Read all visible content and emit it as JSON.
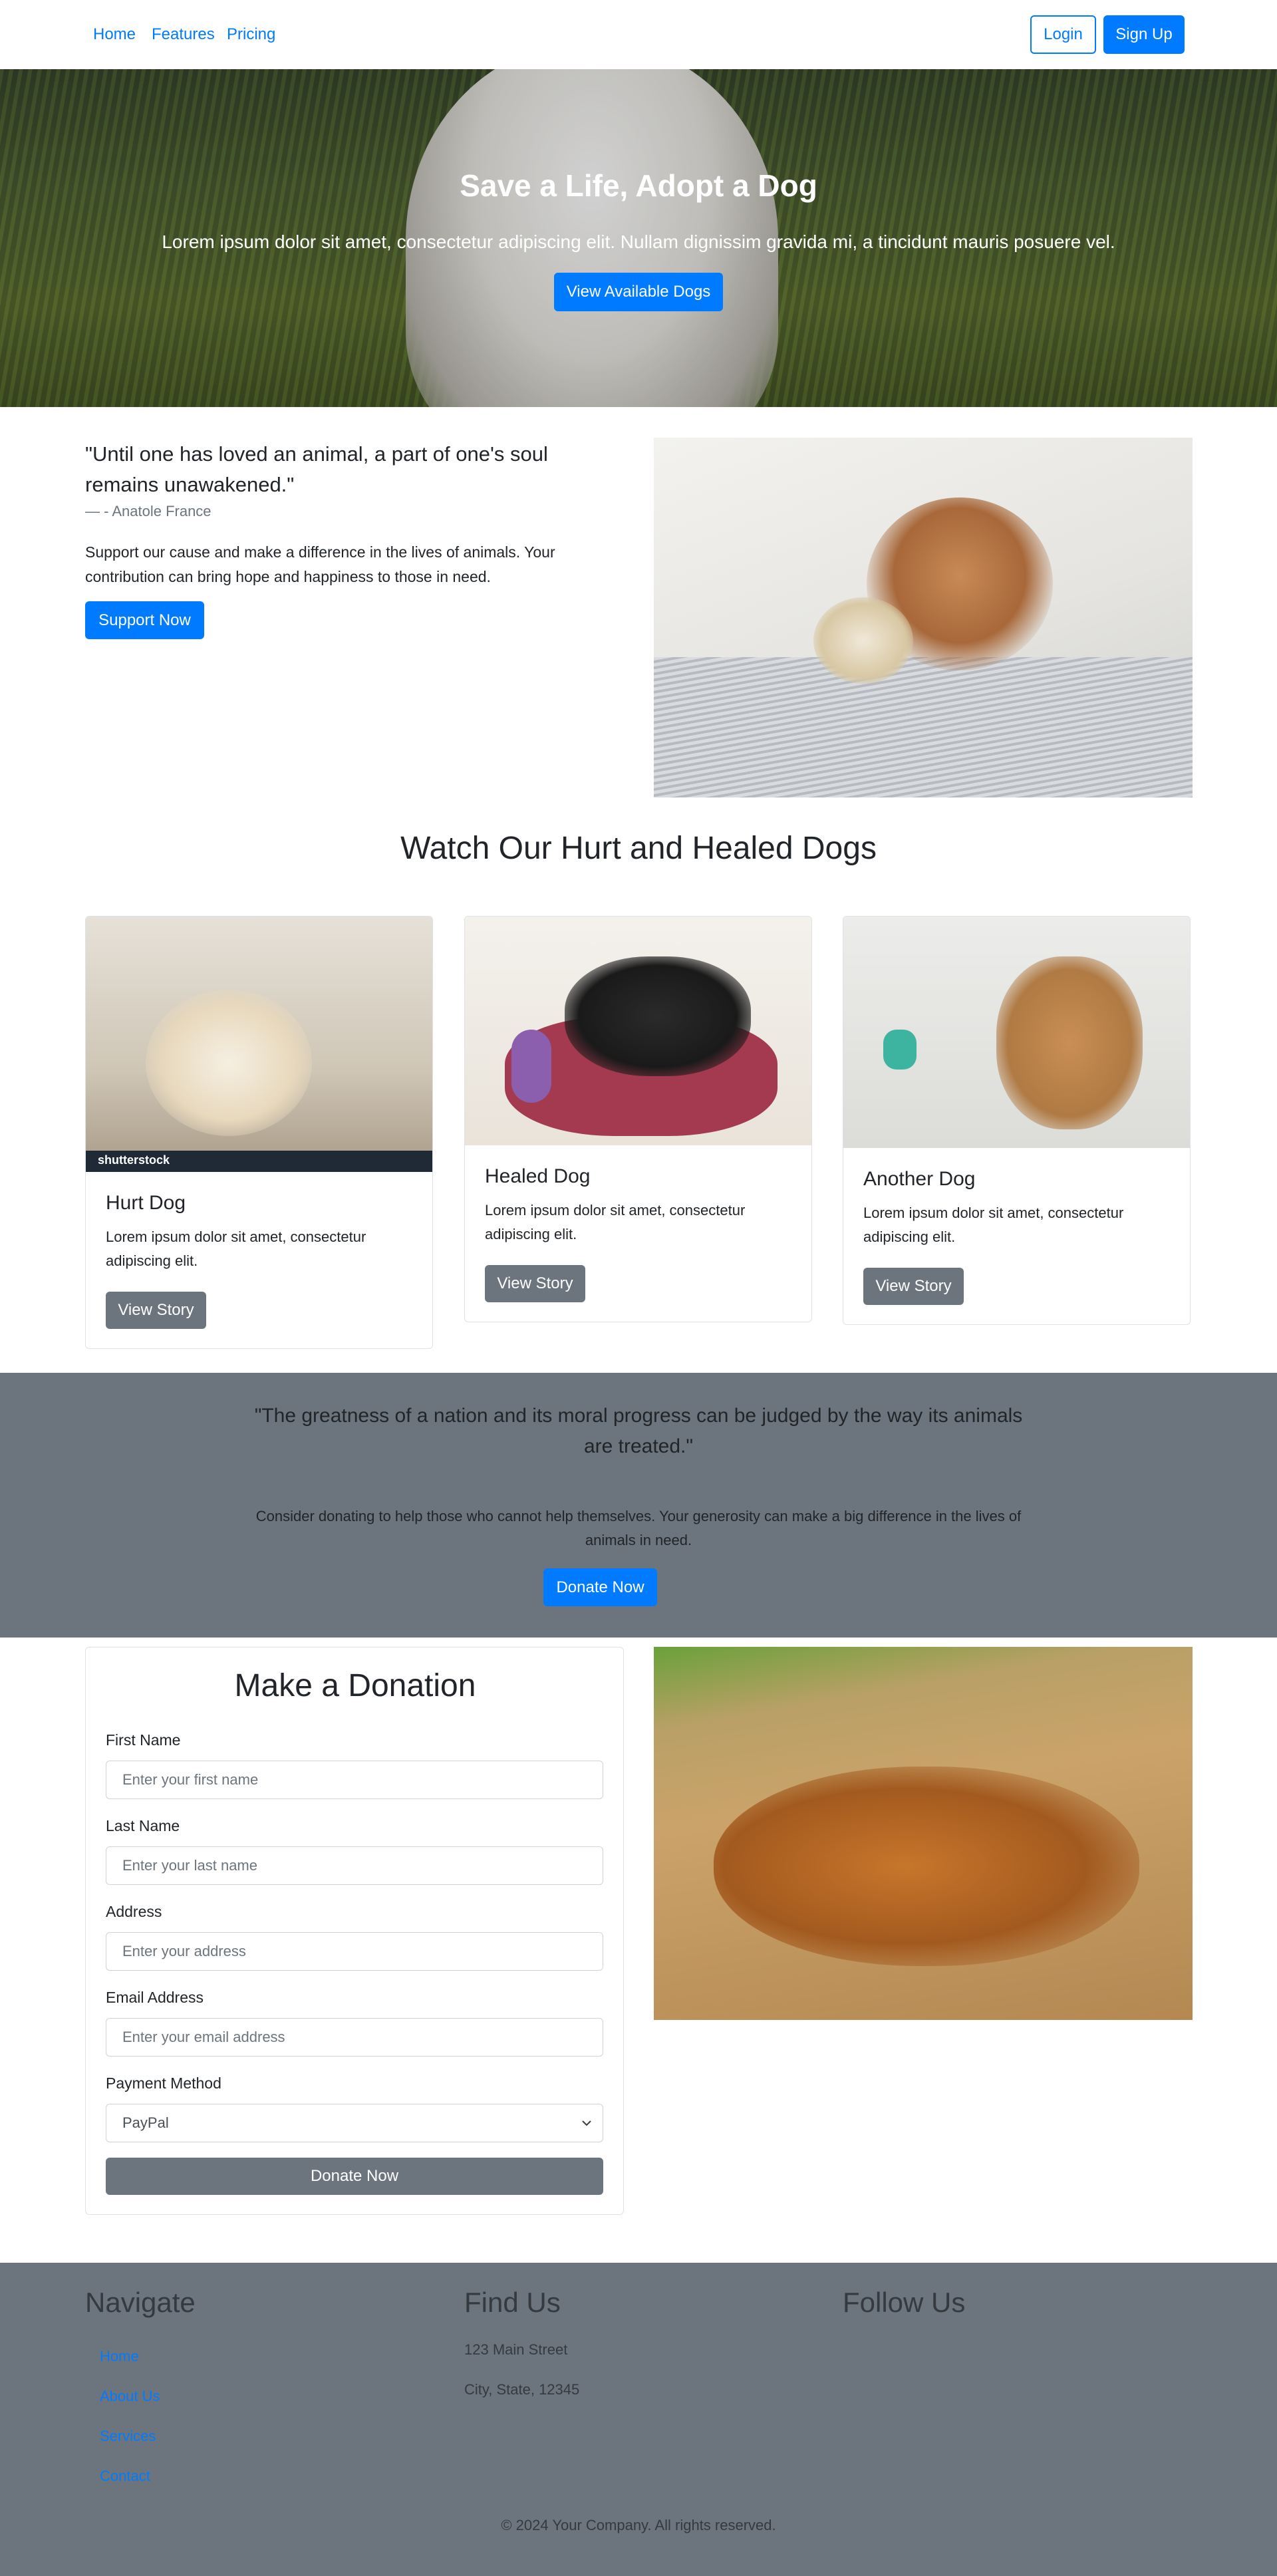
{
  "navbar": {
    "links": [
      "Home",
      "Features",
      "Pricing"
    ],
    "login_label": "Login",
    "signup_label": "Sign Up"
  },
  "hero": {
    "title": "Save a Life, Adopt a Dog",
    "subtitle": "Lorem ipsum dolor sit amet, consectetur adipiscing elit. Nullam dignissim gravida mi, a tincidunt mauris posuere vel.",
    "button_label": "View Available Dogs"
  },
  "quote_section": {
    "quote": "\"Until one has loved an animal, a part of one's soul remains unawakened.\"",
    "author": "— - Anatole France",
    "text": "Support our cause and make a difference in the lives of animals. Your contribution can bring hope and happiness to those in need.",
    "button_label": "Support Now"
  },
  "dogs_section": {
    "title": "Watch Our Hurt and Healed Dogs",
    "cards": [
      {
        "title": "Hurt Dog",
        "text": "Lorem ipsum dolor sit amet, consectetur adipiscing elit.",
        "button_label": "View Story"
      },
      {
        "title": "Healed Dog",
        "text": "Lorem ipsum dolor sit amet, consectetur adipiscing elit.",
        "button_label": "View Story"
      },
      {
        "title": "Another Dog",
        "text": "Lorem ipsum dolor sit amet, consectetur adipiscing elit.",
        "button_label": "View Story"
      }
    ],
    "watermark": "shutterstock"
  },
  "grey_band": {
    "quote": "\"The greatness of a nation and its moral progress can be judged by the way its animals are treated.\"",
    "text": "Consider donating to help those who cannot help themselves. Your generosity can make a big difference in the lives of animals in need.",
    "button_label": "Donate Now"
  },
  "donation_form": {
    "title": "Make a Donation",
    "first_name_label": "First Name",
    "first_name_placeholder": "Enter your first name",
    "last_name_label": "Last Name",
    "last_name_placeholder": "Enter your last name",
    "address_label": "Address",
    "address_placeholder": "Enter your address",
    "email_label": "Email Address",
    "email_placeholder": "Enter your email address",
    "payment_label": "Payment Method",
    "payment_selected": "PayPal",
    "submit_label": "Donate Now"
  },
  "footer": {
    "navigate_heading": "Navigate",
    "navigate_links": [
      "Home",
      "About Us",
      "Services",
      "Contact"
    ],
    "find_heading": "Find Us",
    "address_line1": "123 Main Street",
    "address_line2": "City, State, 12345",
    "follow_heading": "Follow Us",
    "copyright": "© 2024 Your Company. All rights reserved."
  },
  "colors": {
    "primary": "#007bff",
    "secondary": "#6c757d"
  }
}
